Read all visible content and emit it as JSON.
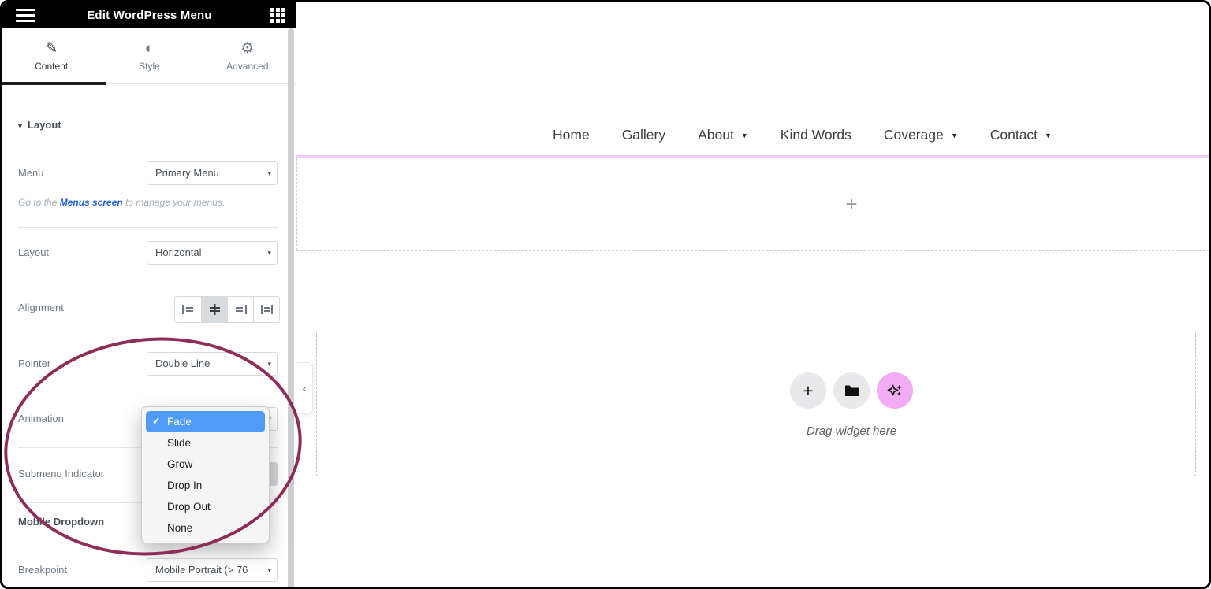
{
  "icons": {
    "pencil": "✎",
    "half_circle": "◐",
    "gear": "⚙",
    "caret_down": "▾",
    "check": "✓",
    "chevron_left": "‹",
    "plus": "+",
    "menu_caret": "▼"
  },
  "panel": {
    "header": {
      "title": "Edit WordPress Menu"
    },
    "tabs": [
      {
        "label": "Content"
      },
      {
        "label": "Style"
      },
      {
        "label": "Advanced"
      }
    ],
    "layout_section": {
      "heading": "Layout",
      "menu": {
        "label": "Menu",
        "value": "Primary Menu"
      },
      "menu_help": {
        "prefix": "Go to the ",
        "link": "Menus screen",
        "suffix": " to manage your menus."
      },
      "layout": {
        "label": "Layout",
        "value": "Horizontal"
      },
      "alignment": {
        "label": "Alignment"
      },
      "pointer": {
        "label": "Pointer",
        "value": "Double Line"
      },
      "animation": {
        "label": "Animation"
      },
      "submenu_indicator": {
        "label": "Submenu Indicator"
      }
    },
    "mobile_dropdown": {
      "heading": "Mobile Dropdown",
      "breakpoint": {
        "label": "Breakpoint",
        "value": "Mobile Portrait (> 76"
      }
    }
  },
  "animation_dropdown": {
    "options": [
      {
        "label": "Fade",
        "selected": true
      },
      {
        "label": "Slide"
      },
      {
        "label": "Grow"
      },
      {
        "label": "Drop In"
      },
      {
        "label": "Drop Out"
      },
      {
        "label": "None"
      }
    ]
  },
  "preview": {
    "menu_items": [
      {
        "label": "Home"
      },
      {
        "label": "Gallery"
      },
      {
        "label": "About",
        "has_submenu": true
      },
      {
        "label": "Kind Words"
      },
      {
        "label": "Coverage",
        "has_submenu": true
      },
      {
        "label": "Contact",
        "has_submenu": true
      }
    ],
    "drag_hint": "Drag widget here"
  },
  "colors": {
    "header_bg": "#000000",
    "dropdown_highlight": "#4f9bf7",
    "annotation_ellipse": "#8e2c5a",
    "widget_outline_pink": "#f3c9f6",
    "ai_button_pink": "#f3abf5",
    "menus_screen_link": "#2563eb"
  }
}
